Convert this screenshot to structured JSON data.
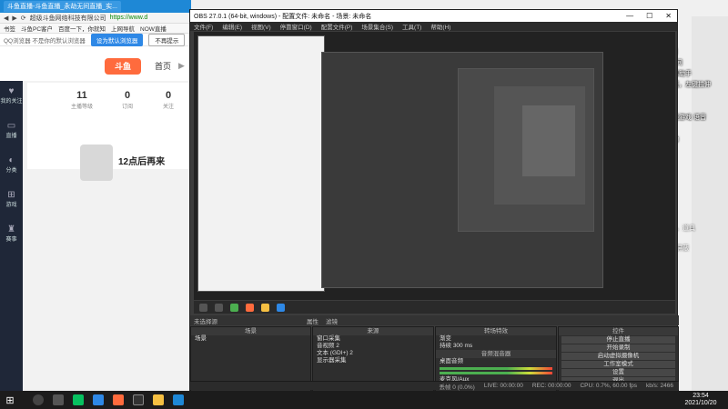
{
  "browser": {
    "tab_label": "斗鱼直播-斗鱼直播_永劫无间直播_实...",
    "tab2_label": "",
    "address_prefix": "超级斗鱼网络科技有限公司",
    "url": "https://www.d",
    "bookmarks": [
      "书签",
      "斗鱼PC客户",
      "百度一下，你就知",
      "上网导航",
      "NOW直播"
    ],
    "notice": "QQ浏览器 不是你的默认浏览器",
    "notice_set_default": "设为默认浏览器",
    "notice_dismiss": "不再提示",
    "header_home": "首页",
    "logo_text": "斗鱼",
    "sidebar": [
      {
        "icon": "heart-icon",
        "label": "我的关注"
      },
      {
        "icon": "tv-icon",
        "label": "直播"
      },
      {
        "icon": "mouse-icon",
        "label": "分类"
      },
      {
        "icon": "gamepad-icon",
        "label": "游戏"
      },
      {
        "icon": "trophy-icon",
        "label": "赛事"
      }
    ],
    "stats": [
      {
        "value": "11",
        "label": "主播等级"
      },
      {
        "value": "0",
        "label": "订阅"
      },
      {
        "value": "0",
        "label": "关注"
      }
    ],
    "stream_title": "12点后再来"
  },
  "obs": {
    "title": "OBS 27.0.1 (64-bit, windows) - 配置文件: 未命名 - 场景: 未命名",
    "menu": [
      "文件(F)",
      "编辑(E)",
      "视图(V)",
      "停靠窗口(D)",
      "配置文件(P)",
      "场景集合(S)",
      "工具(T)",
      "帮助(H)"
    ],
    "source_bar_label": "未选择源",
    "source_bar_props": "属性",
    "source_bar_filters": "滤镜",
    "docks": {
      "scenes": {
        "title": "场景",
        "items": [
          "场景"
        ]
      },
      "sources": {
        "title": "来源",
        "items": [
          "窗口采集",
          "音视频 2",
          "文本 (GDI+) 2",
          "显示器采集"
        ]
      },
      "mixer": {
        "title": "音频混音器",
        "items": [
          "桌面音频",
          "麦克风/Aux"
        ],
        "duration_label": "持续",
        "duration_value": "300 ms"
      },
      "transitions": {
        "title": "转场特效",
        "current": "渐变"
      },
      "controls": {
        "title": "控件",
        "buttons": [
          "停止直播",
          "开始录制",
          "启动虚拟摄像机",
          "工作室模式",
          "设置",
          "退出"
        ]
      }
    },
    "status": {
      "live": "LIVE: 00:00:00",
      "rec": "REC: 00:00:00",
      "cpu": "CPU: 0.7%, 60.00 fps",
      "dropped": "丢帧 0 (0.0%)",
      "kbps": "kb/s: 2466"
    }
  },
  "chat": {
    "messages": [
      {
        "text": "进入直播",
        "highlight": false
      },
      {
        "text": "234... 进入直播间",
        "highlight": false
      },
      {
        "text": "Lv10 ... 进入直播间",
        "highlight": false
      },
      {
        "text": "可以使用斗鱼弹幕助手",
        "highlight": false
      },
      {
        "text": "用可拖动交换位置，左键拉伸",
        "highlight": false
      },
      {
        "text": "调节文本大小",
        "highlight": false
      },
      {
        "text": "右上角设置菜单",
        "highlight": false
      },
      {
        "text": "这里显示弹幕，类游戏 语音",
        "highlight": false
      },
      {
        "text": "粉丝牌升级等",
        "highlight": false
      },
      {
        "text": "添加弹幕助手成功",
        "highlight": false
      }
    ],
    "hint_gifts": "这里显示收到的礼物，道具",
    "hint_screen": "你还可以设置小礼物屏蔽"
  },
  "taskbar": {
    "time": "23:54",
    "date": "2021/10/20"
  },
  "colors": {
    "obs_bg": "#3c3c3c",
    "douyu_orange": "#ff6b3d",
    "taskbar": "#1c1c1c"
  }
}
